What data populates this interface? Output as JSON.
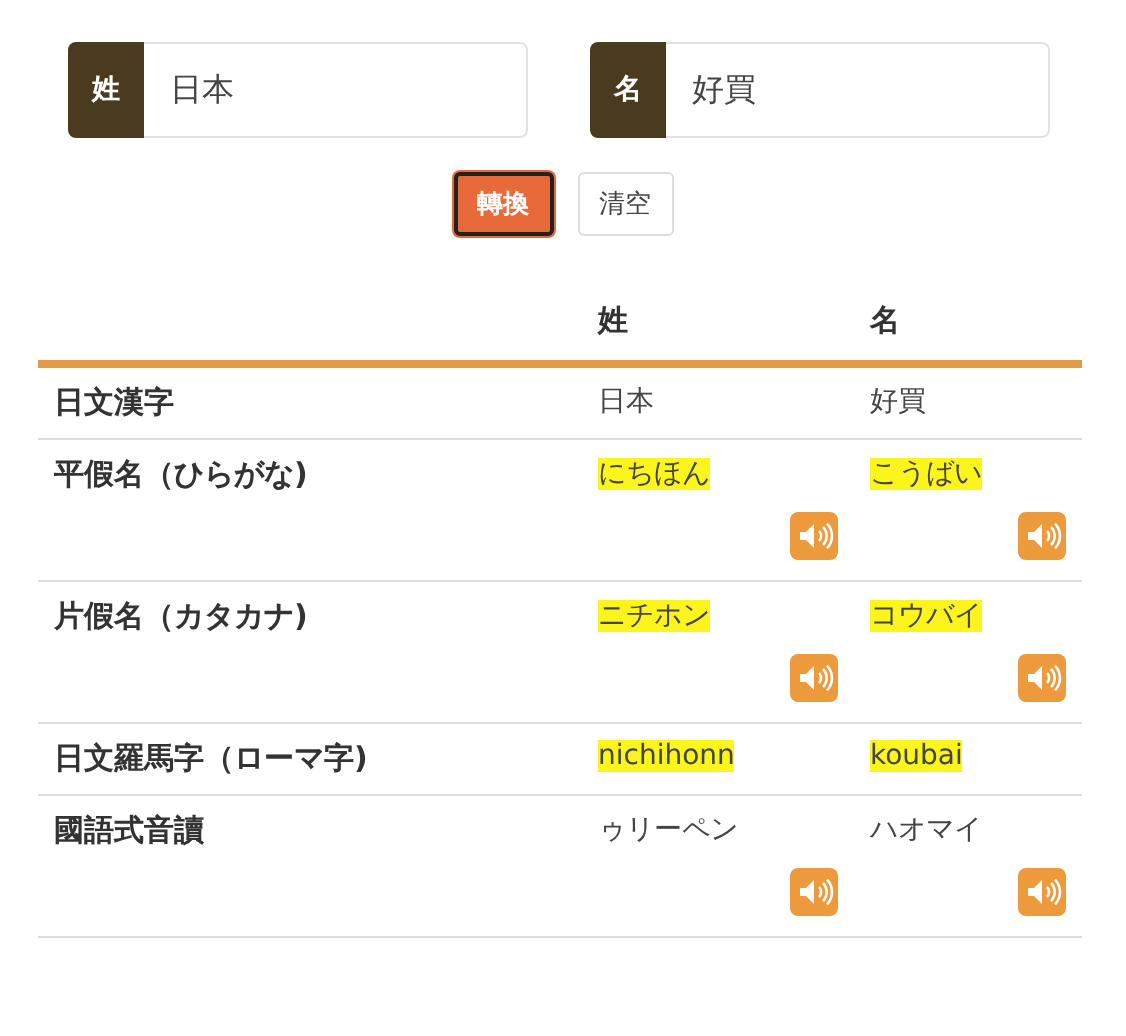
{
  "inputs": [
    {
      "label": "姓",
      "value": "日本"
    },
    {
      "label": "名",
      "value": "好買"
    }
  ],
  "buttons": [
    {
      "label": "轉換",
      "kind": "primary"
    },
    {
      "label": "清空",
      "kind": "default"
    }
  ],
  "table": {
    "columns": [
      "姓",
      "名"
    ],
    "rows": [
      {
        "label": "日文漢字",
        "audio": false,
        "cells": [
          {
            "text": "日本",
            "highlighted": false
          },
          {
            "text": "好買",
            "highlighted": false
          }
        ]
      },
      {
        "label": "平假名（ひらがな)",
        "audio": true,
        "cells": [
          {
            "text": "にちほん",
            "highlighted": true
          },
          {
            "text": "こうばい",
            "highlighted": true
          }
        ]
      },
      {
        "label": "片假名（カタカナ)",
        "audio": true,
        "cells": [
          {
            "text": "ニチホン",
            "highlighted": true
          },
          {
            "text": "コウバイ",
            "highlighted": true
          }
        ]
      },
      {
        "label": "日文羅馬字（ローマ字)",
        "audio": false,
        "cells": [
          {
            "text": "nichihonn",
            "highlighted": true
          },
          {
            "text": "koubai",
            "highlighted": true
          }
        ]
      },
      {
        "label": "國語式音讀",
        "audio": true,
        "cells": [
          {
            "text": "ゥリーペン",
            "highlighted": false
          },
          {
            "text": "ハオマイ",
            "highlighted": false
          }
        ]
      }
    ]
  }
}
